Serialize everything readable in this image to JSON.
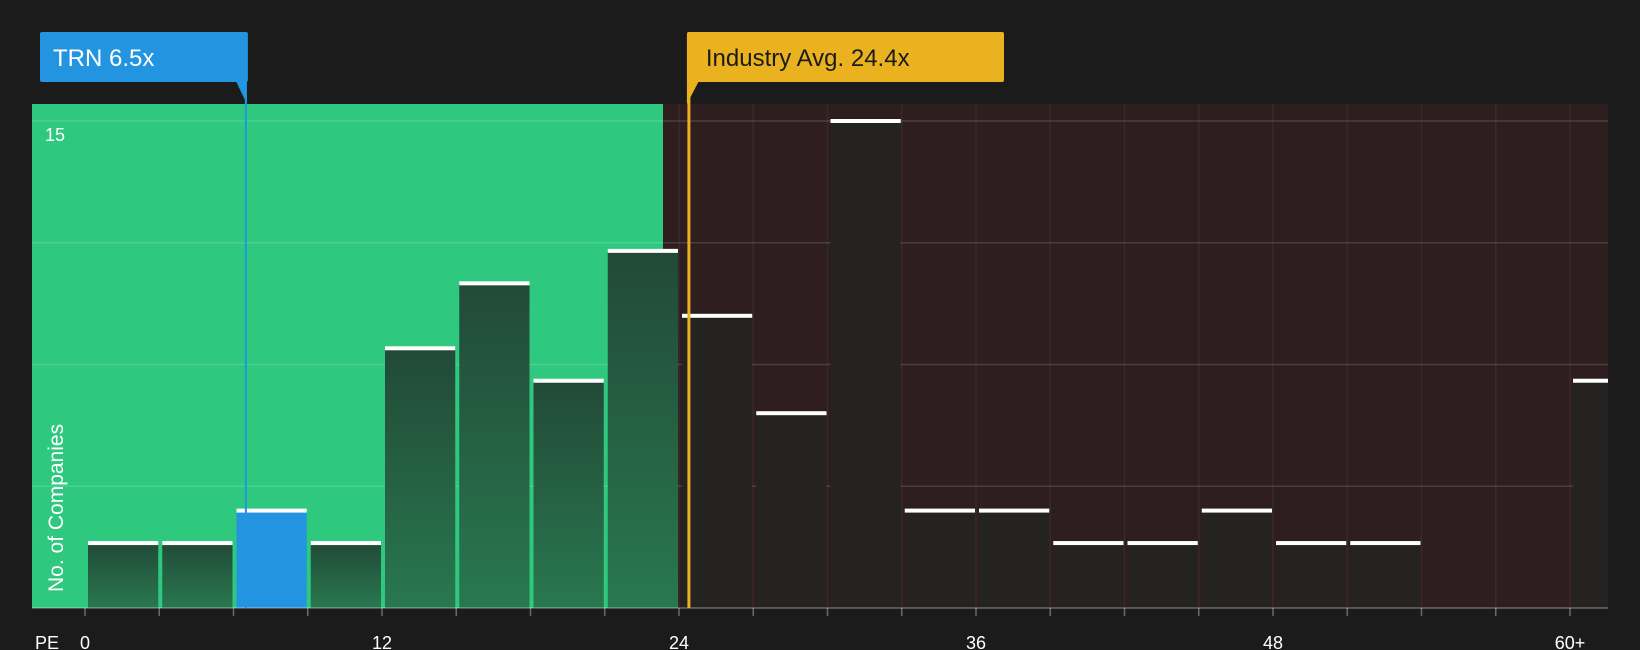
{
  "colors": {
    "background": "#1b1b1b",
    "undervalued_zone": "#2ec97f",
    "overvalued_zone": "#2f1e1f",
    "company_bar": "#2394e0",
    "bar_green_top": "#224a37",
    "bar_green_bottom": "#28784f",
    "bar_dark": "#252222",
    "bar_cap": "#ffffff",
    "industry": "#eab21f",
    "company_line": "#2394e0"
  },
  "company_callout": {
    "label": "TRN 6.5x",
    "ticker": "TRN",
    "value": 6.5
  },
  "industry_callout": {
    "label": "Industry Avg. 24.4x",
    "value": 24.4
  },
  "chart_data": {
    "type": "bar",
    "xlabel": "PE",
    "ylabel": "No. of Companies",
    "x_tick_values": [
      0,
      12,
      24,
      36,
      48,
      60
    ],
    "x_tick_labels": [
      "0",
      "12",
      "24",
      "36",
      "48",
      "60+"
    ],
    "y_tick_labels": [
      "15"
    ],
    "y_gridlines": [
      3.75,
      7.5,
      11.25,
      15
    ],
    "xlim": [
      0,
      61.5
    ],
    "ylim": [
      0,
      15.5
    ],
    "bin_width": 3,
    "undervalued_until": 23.5,
    "bars": [
      {
        "x_start": 0,
        "count": 2
      },
      {
        "x_start": 3,
        "count": 2
      },
      {
        "x_start": 6,
        "count": 3,
        "highlight": true
      },
      {
        "x_start": 9,
        "count": 2
      },
      {
        "x_start": 12,
        "count": 8
      },
      {
        "x_start": 15,
        "count": 10
      },
      {
        "x_start": 18,
        "count": 7
      },
      {
        "x_start": 21,
        "count": 11
      },
      {
        "x_start": 24,
        "count": 9
      },
      {
        "x_start": 27,
        "count": 6
      },
      {
        "x_start": 30,
        "count": 15
      },
      {
        "x_start": 33,
        "count": 3
      },
      {
        "x_start": 36,
        "count": 3
      },
      {
        "x_start": 39,
        "count": 2
      },
      {
        "x_start": 42,
        "count": 2
      },
      {
        "x_start": 45,
        "count": 3
      },
      {
        "x_start": 48,
        "count": 2
      },
      {
        "x_start": 51,
        "count": 2
      },
      {
        "x_start": 54,
        "count": 0
      },
      {
        "x_start": 57,
        "count": 0
      },
      {
        "x_start": 60,
        "count": 7
      }
    ]
  }
}
